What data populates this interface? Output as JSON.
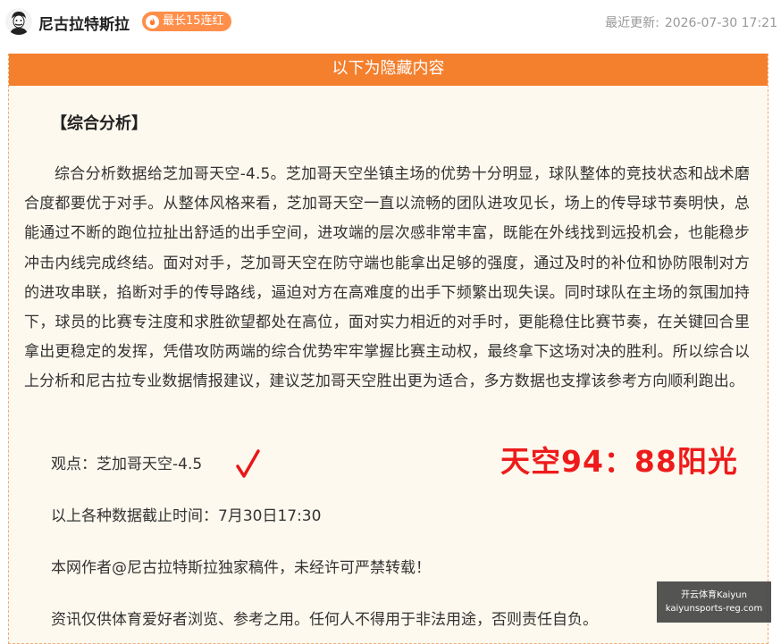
{
  "header": {
    "author_name": "尼古拉特斯拉",
    "streak_badge": "最长15连红",
    "updated_label": "最近更新:",
    "updated_time": "2026-07-30 17:21"
  },
  "content": {
    "banner": "以下为隐藏内容",
    "section_title": "【综合分析】",
    "body": "综合分析数据给芝加哥天空-4.5。芝加哥天空坐镇主场的优势十分明显，球队整体的竞技状态和战术磨合度都要优于对手。从整体风格来看，芝加哥天空一直以流畅的团队进攻见长，场上的传导球节奏明快，总能通过不断的跑位拉扯出舒适的出手空间，进攻端的层次感非常丰富，既能在外线找到远投机会，也能稳步冲击内线完成终结。面对对手，芝加哥天空在防守端也能拿出足够的强度，通过及时的补位和协防限制对方的进攻串联，掐断对手的传导路线，逼迫对方在高难度的出手下频繁出现失误。同时球队在主场的氛围加持下，球员的比赛专注度和求胜欲望都处在高位，面对实力相近的对手时，更能稳住比赛节奏，在关键回合里拿出更稳定的发挥，凭借攻防两端的综合优势牢牢掌握比赛主动权，最终拿下这场对决的胜利。所以综合以上分析和尼古拉专业数据情报建议，建议芝加哥天空胜出更为适合，多方数据也支撑该参考方向顺利跑出。",
    "viewpoint": "观点：芝加哥天空-4.5",
    "result_score": "天空94：88阳光",
    "cutoff": "以上各种数据截止时间：7月30日17:30",
    "copyright": "本网作者@尼古拉特斯拉独家稿件，未经许可严禁转载！",
    "disclaimer": "资讯仅供体育爱好者浏览、参考之用。任何人不得用于非法用途，否则责任自负。"
  },
  "watermark": {
    "line1": "开云体育Kaiyun",
    "line2": "kaiyunsports-reg.com"
  },
  "colors": {
    "accent": "#f47f2d",
    "badge": "#ff8f4a",
    "score_red": "#ee1b1b",
    "content_bg": "#fef9ee"
  },
  "icons": {
    "avatar": "tesla-portrait-avatar",
    "badge": "fire-icon",
    "check": "red-check-icon"
  }
}
